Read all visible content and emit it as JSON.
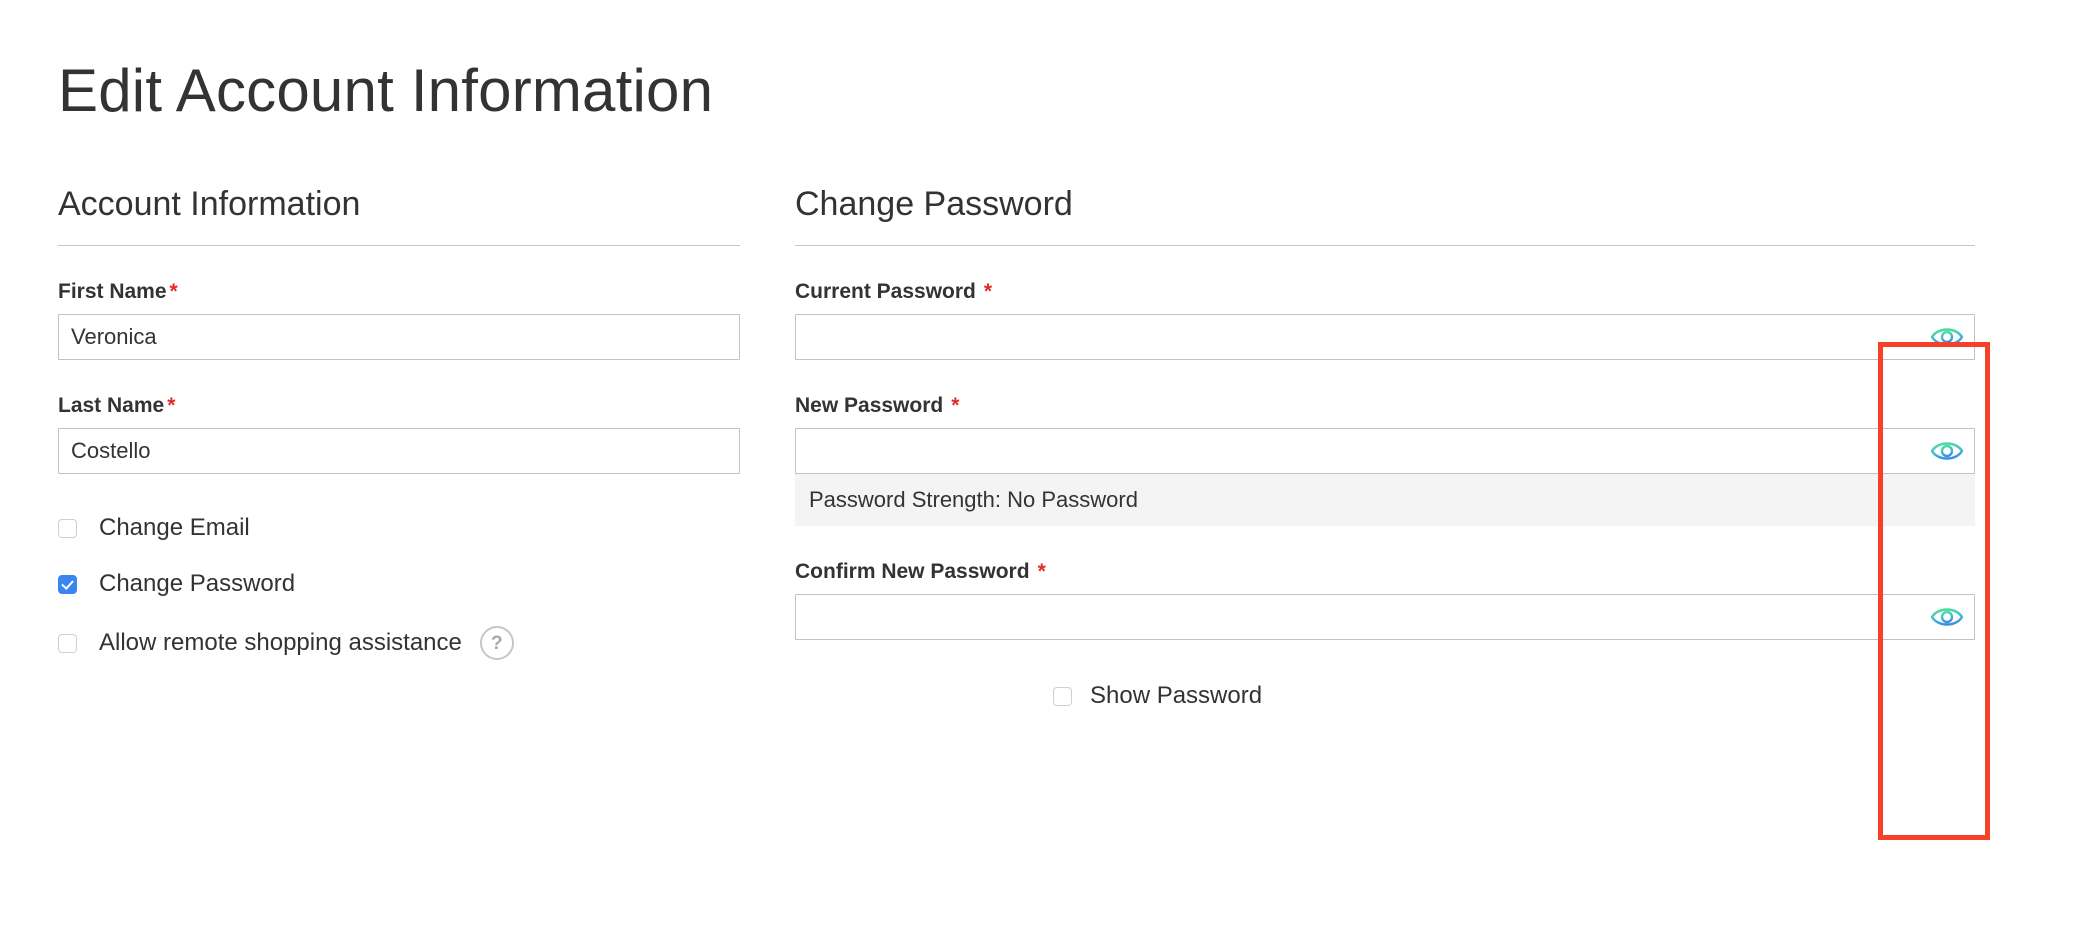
{
  "page": {
    "title": "Edit Account Information"
  },
  "account_information": {
    "legend": "Account Information",
    "first_name": {
      "label": "First Name",
      "required_marker": "*",
      "value": "Veronica"
    },
    "last_name": {
      "label": "Last Name",
      "required_marker": "*",
      "value": "Costello"
    },
    "options": [
      {
        "label": "Change Email",
        "checked": false
      },
      {
        "label": "Change Password",
        "checked": true
      },
      {
        "label": "Allow remote shopping assistance",
        "checked": false,
        "help_icon": "?"
      }
    ]
  },
  "change_password": {
    "legend": "Change Password",
    "current_password": {
      "label": "Current Password",
      "required_marker": "*",
      "value": "",
      "toggle_icon": "eye-icon"
    },
    "new_password": {
      "label": "New Password",
      "required_marker": "*",
      "value": "",
      "toggle_icon": "eye-icon",
      "strength_text": "Password Strength: No Password"
    },
    "confirm_new_password": {
      "label": "Confirm New Password",
      "required_marker": "*",
      "value": "",
      "toggle_icon": "eye-icon"
    },
    "show_password": {
      "label": "Show Password",
      "checked": false
    }
  },
  "colors": {
    "required_asterisk": "#e02b27",
    "checkbox_checked": "#3a86f0",
    "annotation_border": "#f4422a",
    "eye_gradient_start": "#4ade9b",
    "eye_gradient_end": "#3b8ee6",
    "input_border": "#c2c2c2",
    "strength_background": "#f4f4f4",
    "text": "#333333"
  }
}
